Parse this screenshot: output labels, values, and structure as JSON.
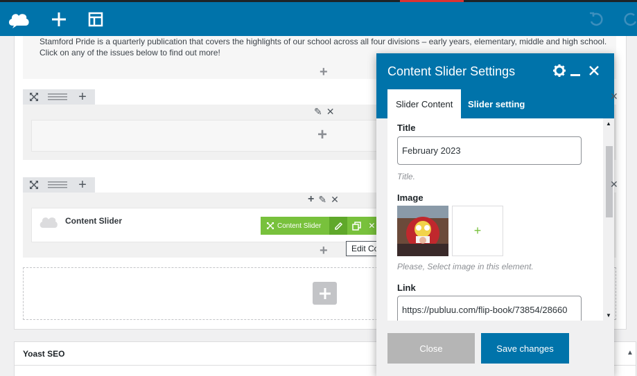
{
  "toolbar": {
    "logo_icon": "cloud-logo",
    "add_icon": "plus-icon",
    "layout_icon": "layout-template-icon",
    "undo_icon": "undo-icon",
    "redo_icon": "redo-icon"
  },
  "editor": {
    "intro_text": "Stamford Pride is a quarterly publication that covers the highlights of our school across all four divisions – early years, elementary, middle and high school. Click on any of the issues below to find out more!",
    "element_label": "Content Slider",
    "element_bar_name": "Content Slider",
    "tooltip": "Edit Content Slider"
  },
  "yoast": {
    "title": "Yoast SEO"
  },
  "modal": {
    "title": "Content Slider Settings",
    "tabs": [
      {
        "label": "Slider Content",
        "active": true
      },
      {
        "label": "Slider setting",
        "active": false
      }
    ],
    "fields": {
      "title_label": "Title",
      "title_value": "February 2023",
      "title_help": "Title.",
      "image_label": "Image",
      "image_help": "Please, Select image in this element.",
      "link_label": "Link",
      "link_value": "https://publuu.com/flip-book/73854/28660"
    },
    "buttons": {
      "close": "Close",
      "save": "Save changes"
    }
  },
  "colors": {
    "brand_blue": "#0073aa",
    "green": "#78c13c"
  }
}
